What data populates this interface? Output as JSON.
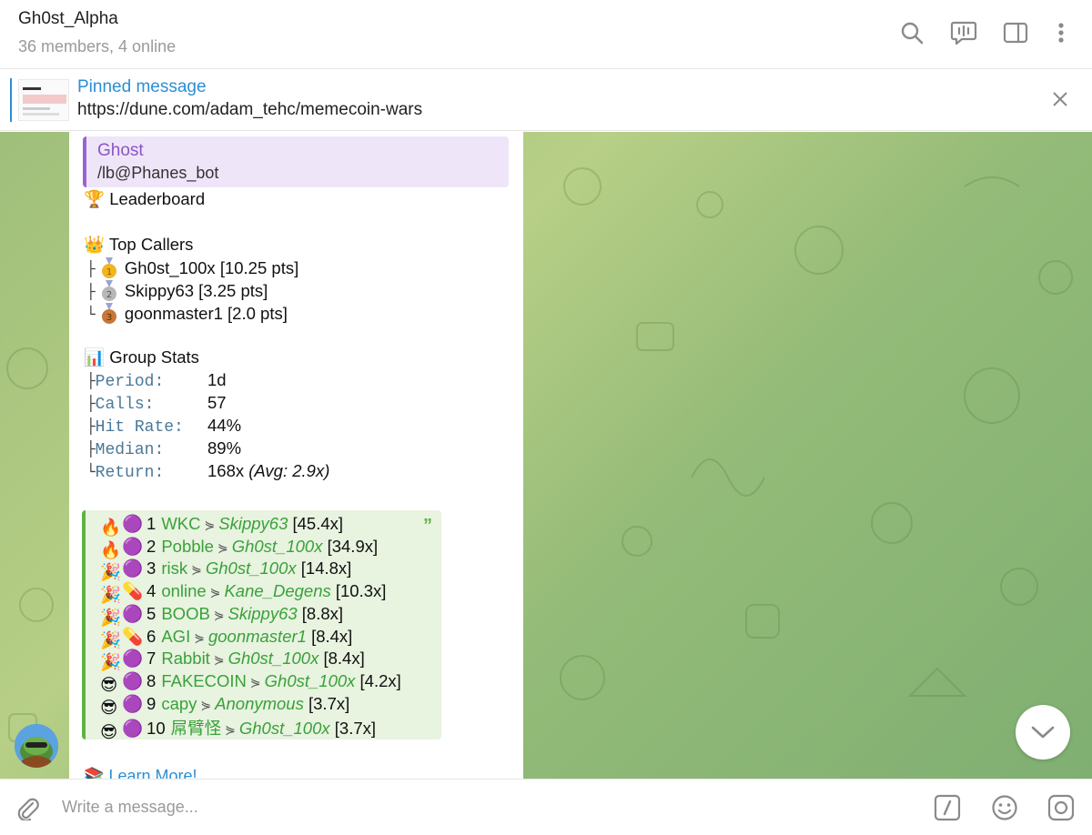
{
  "header": {
    "title": "Gh0st_Alpha",
    "subtitle": "36 members, 4 online",
    "icons": [
      "search-icon",
      "voice-chat-icon",
      "sidebar-icon",
      "more-icon"
    ]
  },
  "pinned": {
    "label": "Pinned message",
    "text": "https://dune.com/adam_tehc/memecoin-wars"
  },
  "message": {
    "reply": {
      "name": "Ghost",
      "text": "/lb@Phanes_bot"
    },
    "leaderboard_title": "Leaderboard",
    "top_callers_title": "Top Callers",
    "callers": [
      {
        "name": "Gh0st_100x",
        "pts": "[10.25 pts]",
        "medal": "gold"
      },
      {
        "name": "Skippy63",
        "pts": "[3.25 pts]",
        "medal": "silver"
      },
      {
        "name": "goonmaster1",
        "pts": "[2.0 pts]",
        "medal": "bronze"
      }
    ],
    "group_stats_title": "Group Stats",
    "stats": [
      {
        "label": "Period:",
        "value": "1d"
      },
      {
        "label": "Calls:",
        "value": "57"
      },
      {
        "label": "Hit Rate:",
        "value": "44%"
      },
      {
        "label": "Median:",
        "value": "89%"
      },
      {
        "label": "Return:",
        "value": "168x",
        "extra": "(Avg: 2.9x)"
      }
    ],
    "calls": [
      {
        "icon": "fire",
        "rank": "1",
        "ticker": "WKC",
        "user": "Skippy63",
        "mult": "[45.4x]"
      },
      {
        "icon": "fire",
        "rank": "2",
        "ticker": "Pobble",
        "user": "Gh0st_100x",
        "mult": "[34.9x]"
      },
      {
        "icon": "party",
        "rank": "3",
        "ticker": "risk",
        "user": "Gh0st_100x",
        "mult": "[14.8x]"
      },
      {
        "icon": "party",
        "rank": "4",
        "ticker": "online",
        "user": "Kane_Degens",
        "mult": "[10.3x]"
      },
      {
        "icon": "party",
        "rank": "5",
        "ticker": "BOOB",
        "user": "Skippy63",
        "mult": "[8.8x]"
      },
      {
        "icon": "party",
        "rank": "6",
        "ticker": "AGI",
        "user": "goonmaster1",
        "mult": "[8.4x]"
      },
      {
        "icon": "party",
        "rank": "7",
        "ticker": "Rabbit",
        "user": "Gh0st_100x",
        "mult": "[8.4x]"
      },
      {
        "icon": "cool",
        "rank": "8",
        "ticker": "FAKECOIN",
        "user": "Gh0st_100x",
        "mult": "[4.2x]"
      },
      {
        "icon": "cool",
        "rank": "9",
        "ticker": "capy",
        "user": "Anonymous",
        "mult": "[3.7x]"
      },
      {
        "icon": "cool",
        "rank": "10",
        "ticker": "屌臂怪",
        "user": "Gh0st_100x",
        "mult": "[3.7x]"
      }
    ],
    "learn_more": "Learn More!"
  },
  "composer": {
    "placeholder": "Write a message..."
  },
  "colors": {
    "accent": "#2b8ed6",
    "reply_accent": "#9a63d4",
    "quote_accent": "#5fb344"
  }
}
